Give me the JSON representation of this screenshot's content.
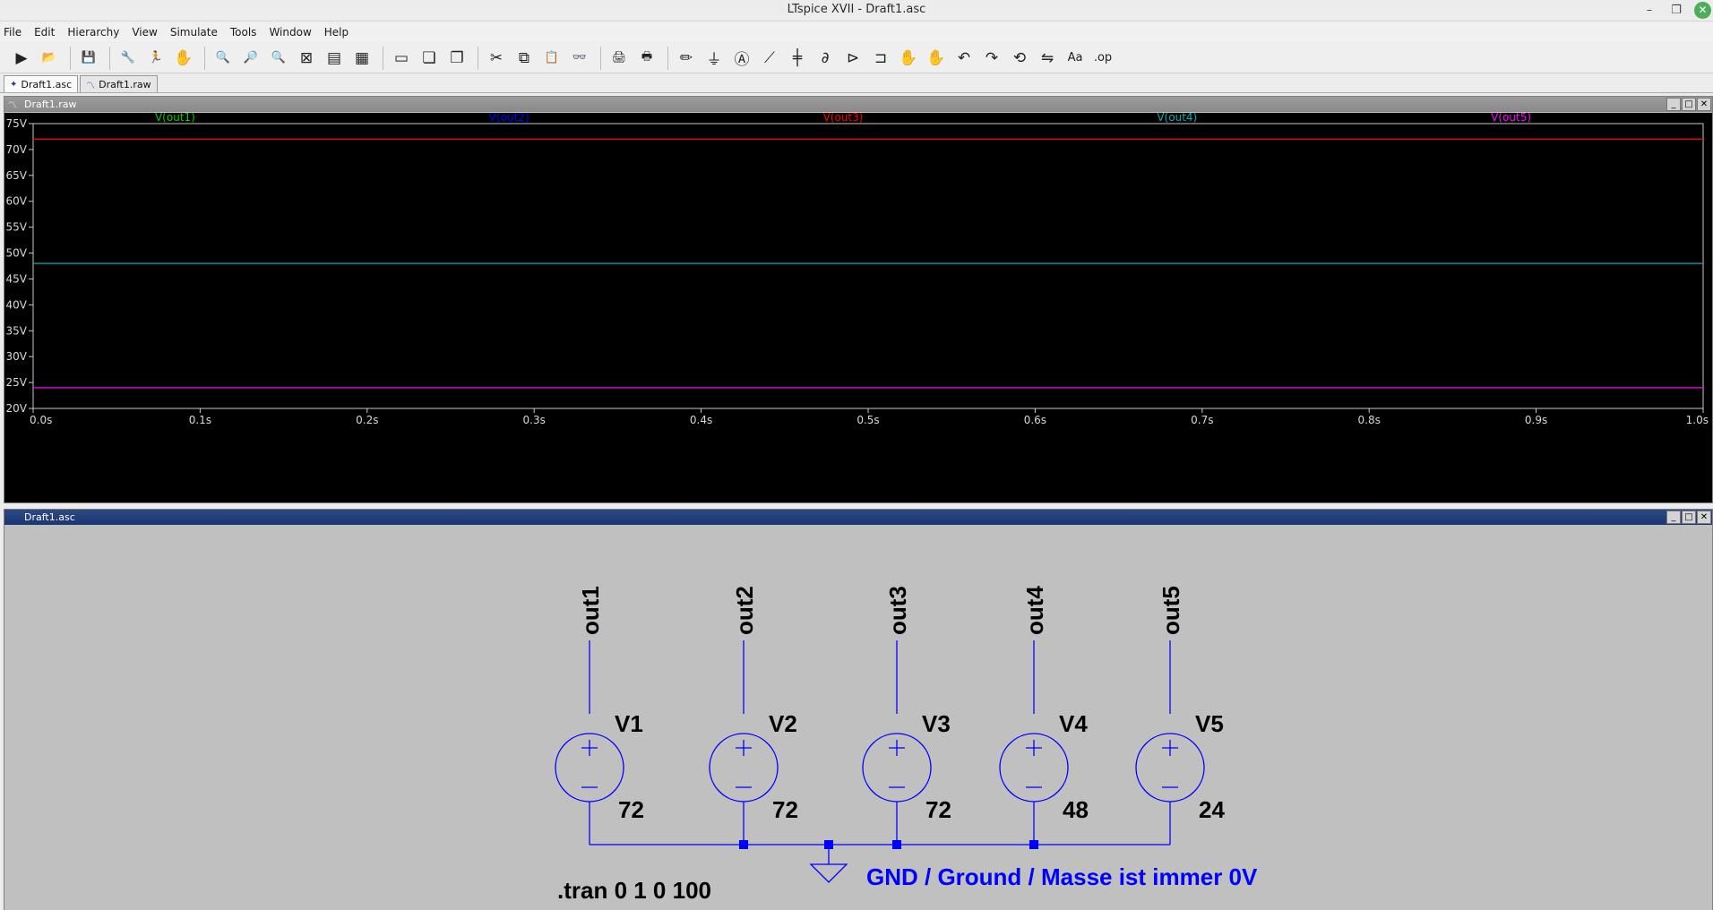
{
  "window": {
    "title": "LTspice XVII - Draft1.asc",
    "minimize_glyph": "–",
    "maximize_glyph": "❐",
    "close_glyph": "✕"
  },
  "menu": {
    "items": [
      "File",
      "Edit",
      "Hierarchy",
      "View",
      "Simulate",
      "Tools",
      "Window",
      "Help"
    ]
  },
  "toolbar": {
    "buttons": [
      {
        "name": "run-icon",
        "glyph": "▶"
      },
      {
        "name": "open-icon",
        "glyph": "📂"
      },
      {
        "name": "save-icon",
        "glyph": "💾"
      },
      {
        "name": "control-panel-icon",
        "glyph": "🔧"
      },
      {
        "name": "halt-icon",
        "glyph": "🏃"
      },
      {
        "name": "pan-icon",
        "glyph": "✋"
      },
      {
        "name": "zoom-in-icon",
        "glyph": "🔍"
      },
      {
        "name": "zoom-area-icon",
        "glyph": "🔎"
      },
      {
        "name": "zoom-out-icon",
        "glyph": "🔍"
      },
      {
        "name": "zoom-fit-icon",
        "glyph": "⊠"
      },
      {
        "name": "autorange-icon",
        "glyph": "▤"
      },
      {
        "name": "mark-icon",
        "glyph": "▦"
      },
      {
        "name": "tile-horizontal-icon",
        "glyph": "▭"
      },
      {
        "name": "cascade-icon",
        "glyph": "❏"
      },
      {
        "name": "tile-vertical-icon",
        "glyph": "❐"
      },
      {
        "name": "cut-icon",
        "glyph": "✂"
      },
      {
        "name": "copy-icon",
        "glyph": "⧉"
      },
      {
        "name": "paste-icon",
        "glyph": "📋"
      },
      {
        "name": "find-icon",
        "glyph": "👓"
      },
      {
        "name": "print-icon",
        "glyph": "🖨"
      },
      {
        "name": "print-setup-icon",
        "glyph": "🖶"
      },
      {
        "name": "wire-icon",
        "glyph": "✏"
      },
      {
        "name": "ground-icon",
        "glyph": "⏚"
      },
      {
        "name": "label-net-icon",
        "glyph": "Ⓐ"
      },
      {
        "name": "resistor-icon",
        "glyph": "⟋"
      },
      {
        "name": "capacitor-icon",
        "glyph": "╪"
      },
      {
        "name": "inductor-icon",
        "glyph": "∂"
      },
      {
        "name": "diode-icon",
        "glyph": "⊳"
      },
      {
        "name": "component-icon",
        "glyph": "⊐"
      },
      {
        "name": "move-icon",
        "glyph": "✋"
      },
      {
        "name": "drag-icon",
        "glyph": "✋"
      },
      {
        "name": "undo-icon",
        "glyph": "↶"
      },
      {
        "name": "redo-icon",
        "glyph": "↷"
      },
      {
        "name": "rotate-icon",
        "glyph": "⟲"
      },
      {
        "name": "mirror-icon",
        "glyph": "⇋"
      },
      {
        "name": "text-icon",
        "glyph": "Aa"
      },
      {
        "name": "spice-directive-icon",
        "glyph": ".op"
      }
    ]
  },
  "tabs": [
    {
      "label": "Draft1.asc",
      "icon": "schematic-icon"
    },
    {
      "label": "Draft1.raw",
      "icon": "waveform-icon"
    }
  ],
  "waveform_window": {
    "title": "Draft1.raw",
    "background": "#000000",
    "chart_data": {
      "type": "line",
      "x_ticks": [
        "0.0s",
        "0.1s",
        "0.2s",
        "0.3s",
        "0.4s",
        "0.5s",
        "0.6s",
        "0.7s",
        "0.8s",
        "0.9s",
        "1.0s"
      ],
      "y_ticks": [
        "75V",
        "70V",
        "65V",
        "60V",
        "55V",
        "50V",
        "45V",
        "40V",
        "35V",
        "30V",
        "25V",
        "20V"
      ],
      "xlim": [
        0,
        1.0
      ],
      "ylim": [
        20,
        75
      ],
      "series": [
        {
          "name": "V(out1)",
          "color": "#00cc00",
          "x": [
            0,
            1.0
          ],
          "y": [
            72,
            72
          ]
        },
        {
          "name": "V(out2)",
          "color": "#0000ff",
          "x": [
            0,
            1.0
          ],
          "y": [
            72,
            72
          ]
        },
        {
          "name": "V(out3)",
          "color": "#ff0000",
          "x": [
            0,
            1.0
          ],
          "y": [
            72,
            72
          ]
        },
        {
          "name": "V(out4)",
          "color": "#00b0b0",
          "x": [
            0,
            1.0
          ],
          "y": [
            48,
            48
          ]
        },
        {
          "name": "V(out5)",
          "color": "#ff00ff",
          "x": [
            0,
            1.0
          ],
          "y": [
            24,
            24
          ]
        }
      ]
    }
  },
  "schematic_window": {
    "title": "Draft1.asc",
    "wire_color": "#0000ff",
    "sources": [
      {
        "name": "V1",
        "value": "72",
        "net": "out1"
      },
      {
        "name": "V2",
        "value": "72",
        "net": "out2"
      },
      {
        "name": "V3",
        "value": "72",
        "net": "out3"
      },
      {
        "name": "V4",
        "value": "48",
        "net": "out4"
      },
      {
        "name": "V5",
        "value": "24",
        "net": "out5"
      }
    ],
    "ground_comment": "GND / Ground / Masse ist immer 0V",
    "directive": ".tran 0 1 0 100"
  }
}
